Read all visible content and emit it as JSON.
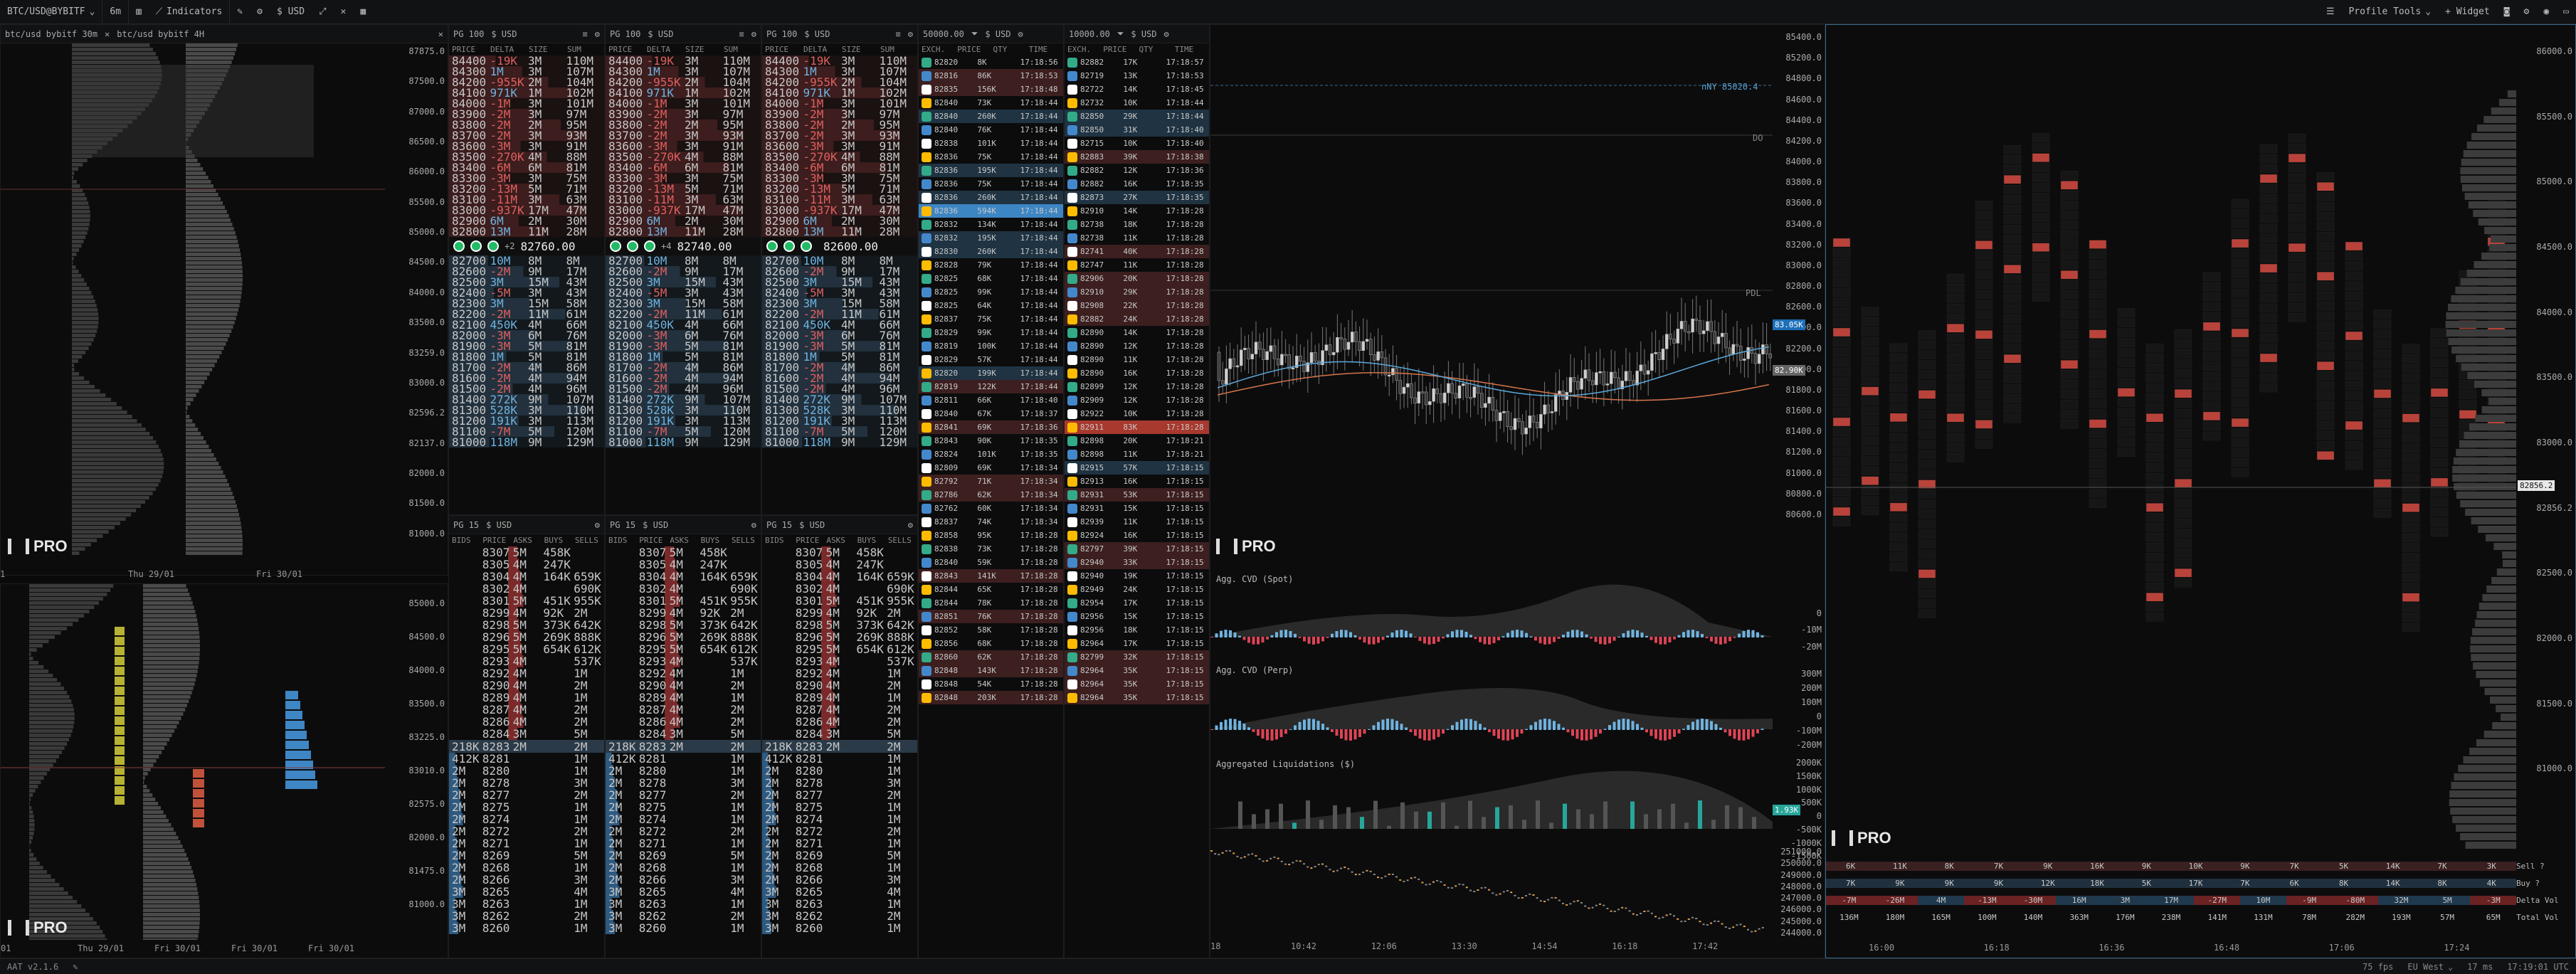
{
  "topbar": {
    "symbol": "BTC/USD@BYBITF",
    "timeframe": "6m",
    "indicators": "Indicators",
    "currency": "$ USD",
    "profile_tools": "Profile Tools",
    "widget": "+ Widget"
  },
  "left_chart": {
    "tab1": "btc/usd bybitf 30m",
    "tab2": "btc/usd bybitf 4H",
    "y_top": [
      "87875.0",
      "87500.0",
      "87000.0",
      "86500.0",
      "86000.0",
      "85500.0",
      "85000.0",
      "84500.0",
      "84000.0",
      "83500.0",
      "83259.0",
      "83000.0",
      "82596.2",
      "82137.0",
      "82000.0",
      "81500.0",
      "81000.0"
    ],
    "y_bottom": [
      "85000.0",
      "84500.0",
      "84000.0",
      "83500.0",
      "83225.0",
      "83010.0",
      "82575.0",
      "82000.0",
      "81475.0",
      "81000.0"
    ],
    "x_top": [
      "1",
      "Thu 29/01",
      "Fri 30/01"
    ],
    "x_bottom": [
      "01",
      "Thu 29/01",
      "Fri 30/01",
      "Fri 30/01",
      "Fri 30/01"
    ]
  },
  "books": [
    {
      "group": "PG 100",
      "ccy": "$ USD",
      "mid_price": "82760.00",
      "mid_delta": "+2"
    },
    {
      "group": "PG 100",
      "ccy": "$ USD",
      "mid_price": "82740.00",
      "mid_delta": "+4"
    },
    {
      "group": "PG 100",
      "ccy": "$ USD",
      "mid_price": "82600.00",
      "mid_delta": ""
    }
  ],
  "book_cols": [
    "PRICE",
    "DELTA",
    "SIZE",
    "SUM"
  ],
  "book_asks": [
    [
      "84400",
      "-19K",
      "3M",
      "110M"
    ],
    [
      "84300",
      "1M",
      "3M",
      "107M"
    ],
    [
      "84200",
      "-955K",
      "2M",
      "104M"
    ],
    [
      "84100",
      "971K",
      "1M",
      "102M"
    ],
    [
      "84000",
      "-1M",
      "3M",
      "101M"
    ],
    [
      "83900",
      "-2M",
      "3M",
      "97M"
    ],
    [
      "83800",
      "-2M",
      "2M",
      "95M"
    ],
    [
      "83700",
      "-2M",
      "3M",
      "93M"
    ],
    [
      "83600",
      "-3M",
      "3M",
      "91M"
    ],
    [
      "83500",
      "-270K",
      "4M",
      "88M"
    ],
    [
      "83400",
      "-6M",
      "6M",
      "81M"
    ],
    [
      "83300",
      "-3M",
      "3M",
      "75M"
    ],
    [
      "83200",
      "-13M",
      "5M",
      "71M"
    ],
    [
      "83100",
      "-11M",
      "3M",
      "63M"
    ],
    [
      "83000",
      "-937K",
      "17M",
      "47M"
    ],
    [
      "82900",
      "6M",
      "2M",
      "30M"
    ],
    [
      "82800",
      "13M",
      "11M",
      "28M"
    ]
  ],
  "book_bids": [
    [
      "82700",
      "10M",
      "8M",
      "8M"
    ],
    [
      "82600",
      "-2M",
      "9M",
      "17M"
    ],
    [
      "82500",
      "3M",
      "15M",
      "43M"
    ],
    [
      "82400",
      "-5M",
      "3M",
      "43M"
    ],
    [
      "82300",
      "3M",
      "15M",
      "58M"
    ],
    [
      "82200",
      "-2M",
      "11M",
      "61M"
    ],
    [
      "82100",
      "450K",
      "4M",
      "66M"
    ],
    [
      "82000",
      "-3M",
      "6M",
      "76M"
    ],
    [
      "81900",
      "-3M",
      "5M",
      "81M"
    ],
    [
      "81800",
      "1M",
      "5M",
      "81M"
    ],
    [
      "81700",
      "-2M",
      "4M",
      "86M"
    ],
    [
      "81600",
      "-2M",
      "4M",
      "94M"
    ],
    [
      "81500",
      "-2M",
      "4M",
      "96M"
    ],
    [
      "81400",
      "272K",
      "9M",
      "107M"
    ],
    [
      "81300",
      "528K",
      "3M",
      "110M"
    ],
    [
      "81200",
      "191K",
      "3M",
      "113M"
    ],
    [
      "81100",
      "-7M",
      "5M",
      "120M"
    ],
    [
      "81000",
      "118M",
      "9M",
      "129M"
    ]
  ],
  "books15": [
    {
      "group": "PG 15",
      "ccy": "$ USD"
    },
    {
      "group": "PG 15",
      "ccy": "$ USD"
    },
    {
      "group": "PG 15",
      "ccy": "$ USD"
    }
  ],
  "book15_cols": [
    "BIDS",
    "PRICE",
    "ASKS",
    "BUYS",
    "SELLS"
  ],
  "book15_asks": [
    [
      "",
      "83070",
      "5M",
      "458K",
      ""
    ],
    [
      "",
      "83055",
      "4M",
      "247K",
      ""
    ],
    [
      "",
      "83040",
      "4M",
      "164K",
      "659K"
    ],
    [
      "",
      "83025",
      "4M",
      "",
      "690K"
    ],
    [
      "",
      "83010",
      "5M",
      "451K",
      "955K"
    ],
    [
      "",
      "82995",
      "4M",
      "92K",
      "2M"
    ],
    [
      "",
      "82980",
      "5M",
      "373K",
      "642K"
    ],
    [
      "",
      "82965",
      "5M",
      "269K",
      "888K"
    ],
    [
      "",
      "82950",
      "5M",
      "654K",
      "612K"
    ],
    [
      "",
      "82935",
      "4M",
      "",
      "537K"
    ],
    [
      "",
      "82920",
      "4M",
      "",
      "1M"
    ],
    [
      "",
      "82905",
      "4M",
      "",
      "2M"
    ],
    [
      "",
      "82890",
      "4M",
      "",
      "1M"
    ],
    [
      "",
      "82875",
      "4M",
      "",
      "2M"
    ],
    [
      "",
      "82860",
      "4M",
      "",
      "2M"
    ],
    [
      "",
      "82845",
      "3M",
      "",
      "5M"
    ]
  ],
  "book15_mid": [
    "218K",
    "82830",
    "2M",
    "",
    "2M"
  ],
  "book15_bids": [
    [
      "412K",
      "82815",
      "",
      "",
      "1M"
    ],
    [
      "2M",
      "82800",
      "",
      "",
      "1M"
    ],
    [
      "2M",
      "82785",
      "",
      "",
      "3M"
    ],
    [
      "2M",
      "82770",
      "",
      "",
      "2M"
    ],
    [
      "2M",
      "82755",
      "",
      "",
      "1M"
    ],
    [
      "2M",
      "82740",
      "",
      "",
      "1M"
    ],
    [
      "2M",
      "82725",
      "",
      "",
      "2M"
    ],
    [
      "2M",
      "82710",
      "",
      "",
      "1M"
    ],
    [
      "2M",
      "82695",
      "",
      "",
      "5M"
    ],
    [
      "2M",
      "82680",
      "",
      "",
      "1M"
    ],
    [
      "2M",
      "82665",
      "",
      "",
      "3M"
    ],
    [
      "3M",
      "82650",
      "",
      "",
      "4M"
    ],
    [
      "3M",
      "82635",
      "",
      "",
      "1M"
    ],
    [
      "3M",
      "82620",
      "",
      "",
      "2M"
    ],
    [
      "3M",
      "82605",
      "",
      "",
      "1M"
    ]
  ],
  "trades_a": {
    "filter": "50000.00",
    "ccy": "$ USD",
    "cols": [
      "EXCH.",
      "PRICE",
      "QTY",
      "TIME"
    ]
  },
  "trades_b": {
    "filter": "10000.00",
    "ccy": "$ USD",
    "cols": [
      "EXCH.",
      "PRICE",
      "QTY",
      "TIME"
    ]
  },
  "trades_left": [
    [
      "82820",
      "8K",
      "17:18:56",
      "n"
    ],
    [
      "82816",
      "86K",
      "17:18:53",
      "r"
    ],
    [
      "82835",
      "156K",
      "17:18:48",
      "r"
    ],
    [
      "82840",
      "73K",
      "17:18:44",
      "g"
    ],
    [
      "82840",
      "260K",
      "17:18:44",
      "b"
    ],
    [
      "82840",
      "76K",
      "17:18:44",
      "g"
    ],
    [
      "82838",
      "101K",
      "17:18:44",
      "g"
    ],
    [
      "82836",
      "75K",
      "17:18:44",
      "g"
    ],
    [
      "82836",
      "195K",
      "17:18:44",
      "b"
    ],
    [
      "82836",
      "75K",
      "17:18:44",
      "g"
    ],
    [
      "82836",
      "260K",
      "17:18:44",
      "b"
    ],
    [
      "82836",
      "594K",
      "17:18:44",
      "B"
    ],
    [
      "82832",
      "134K",
      "17:18:44",
      "g"
    ],
    [
      "82832",
      "195K",
      "17:18:44",
      "b"
    ],
    [
      "82830",
      "260K",
      "17:18:44",
      "b"
    ],
    [
      "82828",
      "79K",
      "17:18:44",
      "g"
    ],
    [
      "82825",
      "68K",
      "17:18:44",
      "g"
    ],
    [
      "82825",
      "99K",
      "17:18:44",
      "g"
    ],
    [
      "82825",
      "64K",
      "17:18:44",
      "g"
    ],
    [
      "82837",
      "75K",
      "17:18:44",
      "g"
    ],
    [
      "82829",
      "99K",
      "17:18:44",
      "g"
    ],
    [
      "82819",
      "100K",
      "17:18:44",
      "g"
    ],
    [
      "82829",
      "57K",
      "17:18:44",
      "g"
    ],
    [
      "82820",
      "199K",
      "17:18:44",
      "b"
    ],
    [
      "82819",
      "122K",
      "17:18:44",
      "r"
    ],
    [
      "82811",
      "66K",
      "17:18:40",
      "g"
    ],
    [
      "82840",
      "67K",
      "17:18:37",
      "g"
    ],
    [
      "82841",
      "69K",
      "17:18:36",
      "r"
    ],
    [
      "82843",
      "90K",
      "17:18:35",
      "g"
    ],
    [
      "82824",
      "101K",
      "17:18:35",
      "g"
    ],
    [
      "82809",
      "69K",
      "17:18:34",
      "g"
    ],
    [
      "82792",
      "71K",
      "17:18:34",
      "r"
    ],
    [
      "82786",
      "62K",
      "17:18:34",
      "r"
    ],
    [
      "82762",
      "60K",
      "17:18:34",
      "g"
    ],
    [
      "82837",
      "74K",
      "17:18:34",
      "g"
    ],
    [
      "82858",
      "95K",
      "17:18:28",
      "g"
    ],
    [
      "82838",
      "73K",
      "17:18:28",
      "g"
    ],
    [
      "82840",
      "59K",
      "17:18:28",
      "g"
    ],
    [
      "82843",
      "141K",
      "17:18:28",
      "r"
    ],
    [
      "82844",
      "65K",
      "17:18:28",
      "g"
    ],
    [
      "82844",
      "78K",
      "17:18:28",
      "g"
    ],
    [
      "82851",
      "76K",
      "17:18:28",
      "r"
    ],
    [
      "82852",
      "58K",
      "17:18:28",
      "g"
    ],
    [
      "82856",
      "68K",
      "17:18:28",
      "g"
    ],
    [
      "82860",
      "62K",
      "17:18:28",
      "r"
    ],
    [
      "82848",
      "143K",
      "17:18:28",
      "r"
    ],
    [
      "82848",
      "54K",
      "17:18:28",
      "g"
    ],
    [
      "82848",
      "203K",
      "17:18:28",
      "r"
    ]
  ],
  "trades_right": [
    [
      "82882",
      "17K",
      "17:18:57",
      "g"
    ],
    [
      "82719",
      "13K",
      "17:18:53",
      "g"
    ],
    [
      "82722",
      "14K",
      "17:18:45",
      "g"
    ],
    [
      "82732",
      "10K",
      "17:18:44",
      "g"
    ],
    [
      "82850",
      "29K",
      "17:18:44",
      "b"
    ],
    [
      "82850",
      "31K",
      "17:18:40",
      "b"
    ],
    [
      "82715",
      "10K",
      "17:18:40",
      "g"
    ],
    [
      "82883",
      "39K",
      "17:18:38",
      "r"
    ],
    [
      "82882",
      "12K",
      "17:18:36",
      "g"
    ],
    [
      "82882",
      "16K",
      "17:18:35",
      "g"
    ],
    [
      "82873",
      "27K",
      "17:18:35",
      "b"
    ],
    [
      "82910",
      "14K",
      "17:18:28",
      "g"
    ],
    [
      "82738",
      "18K",
      "17:18:28",
      "g"
    ],
    [
      "82738",
      "11K",
      "17:18:28",
      "g"
    ],
    [
      "82741",
      "40K",
      "17:18:28",
      "r"
    ],
    [
      "82747",
      "11K",
      "17:18:28",
      "g"
    ],
    [
      "82906",
      "20K",
      "17:18:28",
      "r"
    ],
    [
      "82910",
      "29K",
      "17:18:28",
      "r"
    ],
    [
      "82908",
      "22K",
      "17:18:28",
      "r"
    ],
    [
      "82882",
      "24K",
      "17:18:28",
      "r"
    ],
    [
      "82890",
      "14K",
      "17:18:28",
      "g"
    ],
    [
      "82890",
      "12K",
      "17:18:28",
      "g"
    ],
    [
      "82890",
      "11K",
      "17:18:28",
      "g"
    ],
    [
      "82890",
      "16K",
      "17:18:28",
      "g"
    ],
    [
      "82899",
      "12K",
      "17:18:28",
      "g"
    ],
    [
      "82909",
      "12K",
      "17:18:28",
      "g"
    ],
    [
      "82922",
      "10K",
      "17:18:28",
      "g"
    ],
    [
      "82911",
      "83K",
      "17:18:28",
      "R"
    ],
    [
      "82898",
      "20K",
      "17:18:21",
      "g"
    ],
    [
      "82898",
      "11K",
      "17:18:21",
      "g"
    ],
    [
      "82915",
      "57K",
      "17:18:15",
      "b"
    ],
    [
      "82913",
      "16K",
      "17:18:15",
      "g"
    ],
    [
      "82931",
      "53K",
      "17:18:15",
      "r"
    ],
    [
      "82931",
      "15K",
      "17:18:15",
      "g"
    ],
    [
      "82939",
      "11K",
      "17:18:15",
      "g"
    ],
    [
      "82924",
      "16K",
      "17:18:15",
      "g"
    ],
    [
      "82797",
      "39K",
      "17:18:15",
      "r"
    ],
    [
      "82940",
      "33K",
      "17:18:15",
      "r"
    ],
    [
      "82940",
      "19K",
      "17:18:15",
      "g"
    ],
    [
      "82949",
      "24K",
      "17:18:15",
      "g"
    ],
    [
      "82954",
      "17K",
      "17:18:15",
      "g"
    ],
    [
      "82956",
      "15K",
      "17:18:15",
      "g"
    ],
    [
      "82956",
      "18K",
      "17:18:15",
      "g"
    ],
    [
      "82964",
      "17K",
      "17:18:15",
      "g"
    ],
    [
      "82799",
      "32K",
      "17:18:15",
      "r"
    ],
    [
      "82964",
      "35K",
      "17:18:15",
      "r"
    ],
    [
      "82964",
      "35K",
      "17:18:15",
      "r"
    ],
    [
      "82964",
      "35K",
      "17:18:15",
      "r"
    ]
  ],
  "mid_chart": {
    "labels": {
      "ny": "nNY 85020.4",
      "do": "DO",
      "pdl": "PDL",
      "cvd_spot": "Agg. CVD (Spot)",
      "cvd_perp": "Agg. CVD (Perp)",
      "liq": "Aggregated Liquidations ($)"
    },
    "price_axis": [
      "85400.0",
      "85200.0",
      "84800.0",
      "84600.0",
      "84400.0",
      "84200.0",
      "84000.0",
      "83800.0",
      "83600.0",
      "83400.0",
      "83200.0",
      "83000.0",
      "82800.0",
      "82600.0",
      "82400.0",
      "82200.0",
      "82000.0",
      "81800.0",
      "81600.0",
      "81400.0",
      "81200.0",
      "81000.0",
      "80800.0",
      "80600.0"
    ],
    "price_tag1": "83.05K",
    "price_tag2": "82.90K",
    "cvd_spot_axis": [
      "0",
      "-10M",
      "-20M"
    ],
    "cvd_perp_axis": [
      "300M",
      "200M",
      "100M",
      "0",
      "-100M",
      "-200M"
    ],
    "liq_axis": [
      "2000K",
      "1500K",
      "1000K",
      "500K",
      "0",
      "-500K",
      "-1000K",
      "-1500K"
    ],
    "liq_tag": "1.93K",
    "bottom_axis": [
      "251000.0",
      "250000.0",
      "249000.0",
      "248000.0",
      "247000.0",
      "246000.0",
      "245000.0",
      "244000.0"
    ],
    "x_axis": [
      "18",
      "10:42",
      "12:06",
      "13:30",
      "14:54",
      "16:18",
      "17:42"
    ]
  },
  "footprint": {
    "y_axis": [
      "86000.0",
      "85500.0",
      "85000.0",
      "84500.0",
      "84000.0",
      "83500.0",
      "83000.0",
      "82856.2",
      "82500.0",
      "82000.0",
      "81500.0",
      "81000.0"
    ],
    "price_tag": "82856.2",
    "rows": [
      {
        "label": "Sell ?",
        "vals": [
          "6K",
          "11K",
          "8K",
          "7K",
          "9K",
          "16K",
          "9K",
          "10K",
          "9K",
          "7K",
          "5K",
          "14K",
          "7K",
          "3K"
        ]
      },
      {
        "label": "Buy ?",
        "vals": [
          "7K",
          "9K",
          "9K",
          "9K",
          "12K",
          "18K",
          "5K",
          "17K",
          "7K",
          "6K",
          "8K",
          "14K",
          "8K",
          "4K"
        ]
      },
      {
        "label": "Delta Vol",
        "vals": [
          "-7M",
          "-26M",
          "4M",
          "-13M",
          "-30M",
          "16M",
          "3M",
          "17M",
          "-27M",
          "10M",
          "-9M",
          "-80M",
          "32M",
          "5M",
          "-3M"
        ]
      },
      {
        "label": "Total Vol",
        "vals": [
          "136M",
          "180M",
          "165M",
          "100M",
          "140M",
          "363M",
          "176M",
          "238M",
          "141M",
          "131M",
          "78M",
          "282M",
          "193M",
          "57M",
          "65M"
        ]
      }
    ],
    "x_axis": [
      "16:00",
      "16:18",
      "16:36",
      "16:48",
      "17:06",
      "17:24"
    ]
  },
  "statusbar": {
    "version": "AAT v2.1.6",
    "fps": "75 fps",
    "region": "EU West",
    "latency": "17 ms",
    "time": "17:19:01 UTC"
  },
  "brand": "PRO",
  "colors": {
    "accent": "#1d9bf0",
    "ask": "#c0392b",
    "bid": "#2f6f9f",
    "green": "#26a69a",
    "red": "#e74c3c"
  }
}
